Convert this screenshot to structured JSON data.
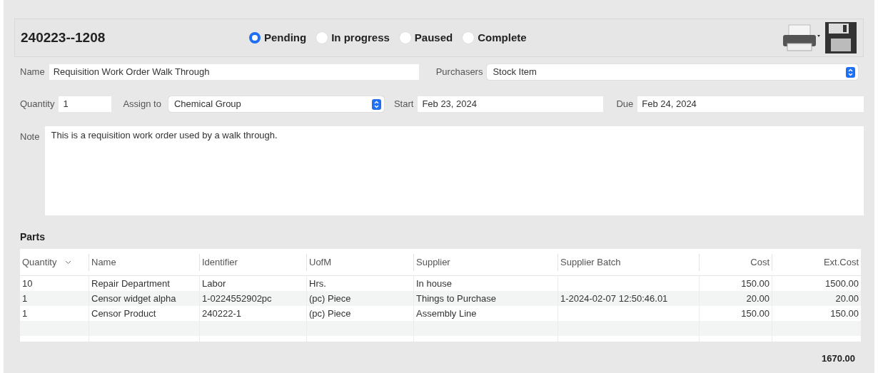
{
  "order_number": "240223--1208",
  "statuses": [
    {
      "label": "Pending",
      "selected": true
    },
    {
      "label": "In progress",
      "selected": false
    },
    {
      "label": "Paused",
      "selected": false
    },
    {
      "label": "Complete",
      "selected": false
    }
  ],
  "name": {
    "label": "Name",
    "value": "Requisition Work Order Walk Through"
  },
  "purchasers": {
    "label": "Purchasers",
    "value": "Stock Item"
  },
  "quantity": {
    "label": "Quantity",
    "value": "1"
  },
  "assign_to": {
    "label": "Assign to",
    "value": "Chemical Group"
  },
  "start": {
    "label": "Start",
    "value": "Feb 23, 2024"
  },
  "due": {
    "label": "Due",
    "value": "Feb 24, 2024"
  },
  "note": {
    "label": "Note",
    "value": "This is a requisition work order used by a walk through."
  },
  "parts": {
    "title": "Parts",
    "columns": [
      {
        "label": "Quantity",
        "kind": "text",
        "sorted": true
      },
      {
        "label": "Name",
        "kind": "text",
        "sorted": false
      },
      {
        "label": "Identifier",
        "kind": "text",
        "sorted": false
      },
      {
        "label": "UofM",
        "kind": "text",
        "sorted": false
      },
      {
        "label": "Supplier",
        "kind": "text",
        "sorted": false
      },
      {
        "label": "Supplier Batch",
        "kind": "text",
        "sorted": false
      },
      {
        "label": "Cost",
        "kind": "money",
        "sorted": false
      },
      {
        "label": "Ext.Cost",
        "kind": "money",
        "sorted": false
      }
    ],
    "rows": [
      [
        "10",
        "Repair Department",
        "Labor",
        "Hrs.",
        "In house",
        null,
        "150.00",
        "1500.00"
      ],
      [
        "1",
        "Censor widget alpha",
        "1-0224552902pc",
        "(pc) Piece",
        "Things to Purchase",
        "1-2024-02-07 12:50:46.01",
        "20.00",
        "20.00"
      ],
      [
        "1",
        "Censor Product",
        "240222-1",
        "(pc) Piece",
        "Assembly Line",
        null,
        "150.00",
        "150.00"
      ]
    ],
    "total": "1670.00"
  }
}
